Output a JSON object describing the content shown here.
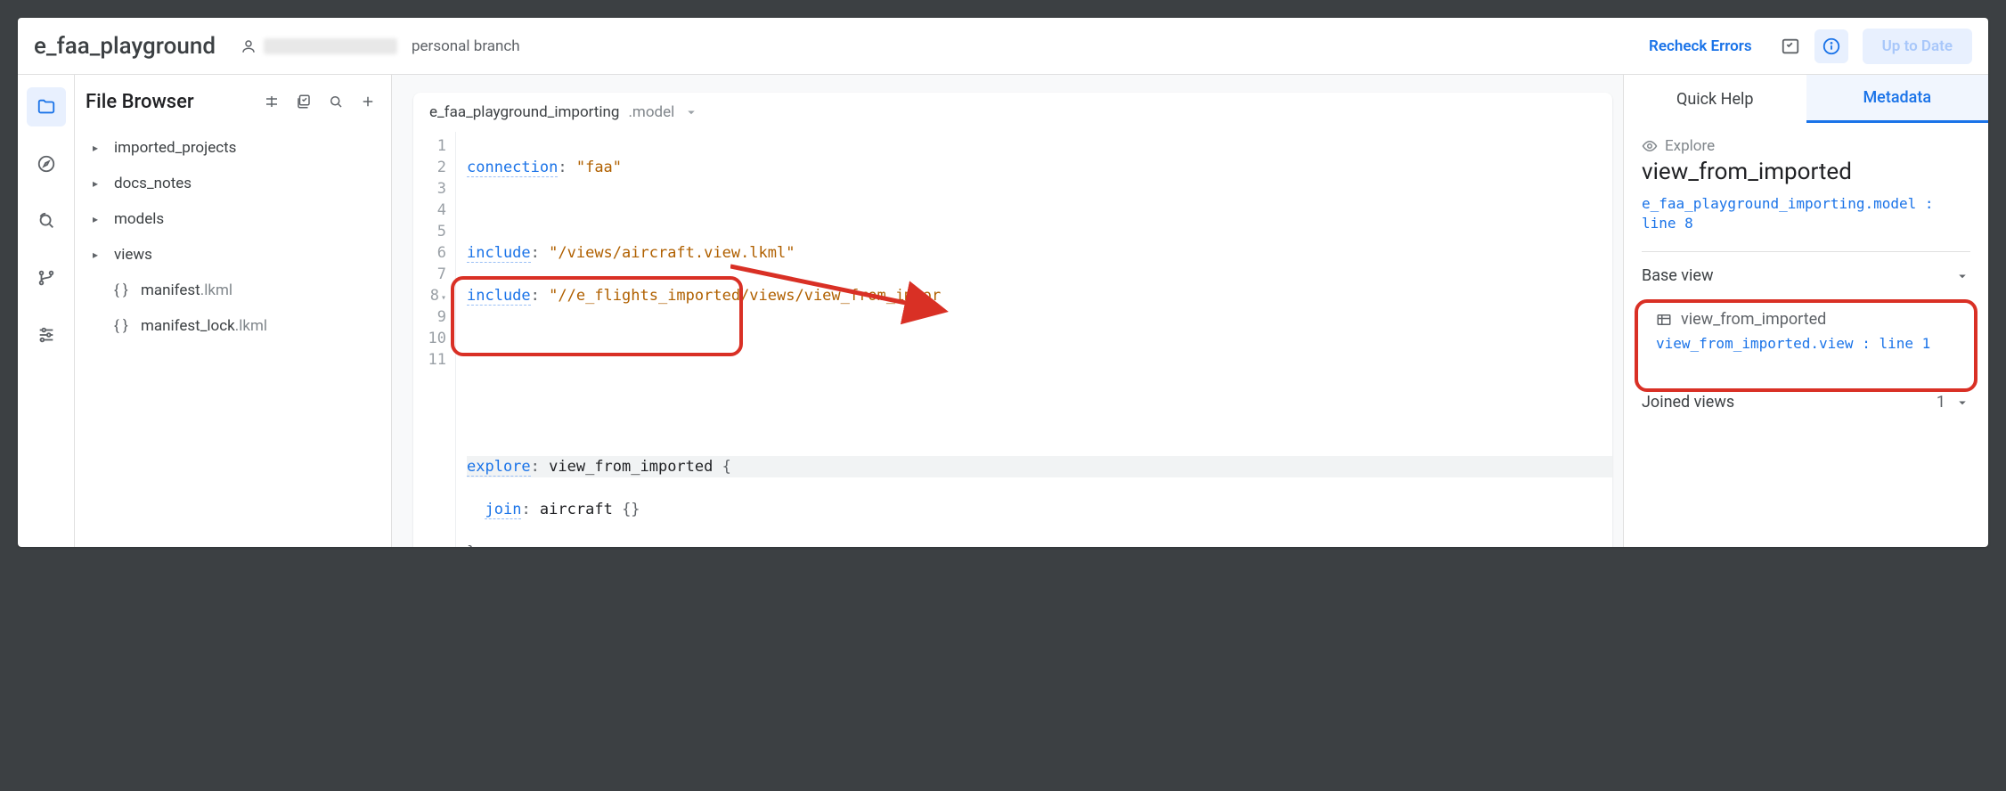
{
  "header": {
    "project_title": "e_faa_playground",
    "branch_label": "personal branch",
    "recheck_label": "Recheck Errors",
    "up_to_date_label": "Up to Date"
  },
  "sidebar": {
    "title": "File Browser",
    "items": [
      {
        "name": "imported_projects",
        "kind": "folder"
      },
      {
        "name": "docs_notes",
        "kind": "folder"
      },
      {
        "name": "models",
        "kind": "folder"
      },
      {
        "name": "views",
        "kind": "folder"
      },
      {
        "name": "manifest",
        "ext": ".lkml",
        "kind": "file"
      },
      {
        "name": "manifest_lock",
        "ext": ".lkml",
        "kind": "file"
      }
    ]
  },
  "editor": {
    "file_name": "e_faa_playground_importing",
    "file_ext": ".model",
    "lines": {
      "l1_key": "connection",
      "l1_val": "\"faa\"",
      "l3_key": "include",
      "l3_val": "\"/views/aircraft.view.lkml\"",
      "l4_key": "include",
      "l4_val": "\"//e_flights_imported/views/view_from_impor",
      "l8_key": "explore",
      "l8_val": "view_from_imported",
      "l9_key": "join",
      "l9_val": "aircraft"
    }
  },
  "panel": {
    "tab_quickhelp": "Quick Help",
    "tab_metadata": "Metadata",
    "eyebrow": "Explore",
    "title": "view_from_imported",
    "source_link": "e_faa_playground_importing.model : line 8",
    "section_baseview": "Base view",
    "baseview_name": "view_from_imported",
    "baseview_link": "view_from_imported.view : line 1",
    "section_joined": "Joined views",
    "joined_count": "1"
  }
}
